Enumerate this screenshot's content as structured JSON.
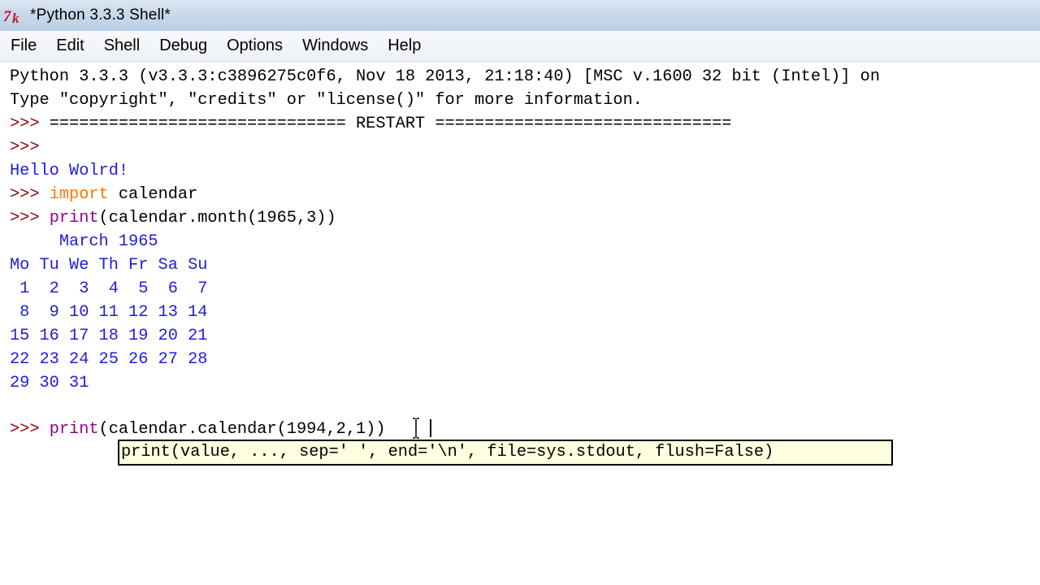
{
  "window": {
    "title": "*Python 3.3.3 Shell*",
    "icon": "tk-icon"
  },
  "menu": {
    "items": [
      "File",
      "Edit",
      "Shell",
      "Debug",
      "Options",
      "Windows",
      "Help"
    ]
  },
  "shell": {
    "banner_line1": "Python 3.3.3 (v3.3.3:c3896275c0f6, Nov 18 2013, 21:18:40) [MSC v.1600 32 bit (Intel)] on",
    "banner_line2": "Type \"copyright\", \"credits\" or \"license()\" for more information.",
    "prompt": ">>> ",
    "restart_line": "============================== RESTART ==============================",
    "hello_output": "Hello Wolrd!",
    "import_keyword": "import",
    "import_rest": " calendar",
    "print_builtin": "print",
    "print_month_rest": "(calendar.month(1965,3))",
    "calendar_title": "     March 1965",
    "calendar_header": "Mo Tu We Th Fr Sa Su",
    "calendar_week1": " 1  2  3  4  5  6  7",
    "calendar_week2": " 8  9 10 11 12 13 14",
    "calendar_week3": "15 16 17 18 19 20 21",
    "calendar_week4": "22 23 24 25 26 27 28",
    "calendar_week5": "29 30 31",
    "current_input_rest": "(calendar.calendar(1994,2,1))"
  },
  "calltip": {
    "text": "print(value, ..., sep=' ', end='\\n', file=sys.stdout, flush=False)"
  },
  "colors": {
    "titlebar": "#c9d8ea",
    "prompt": "#8a0000",
    "output_blue": "#1e1ed8",
    "keyword_orange": "#ff7700",
    "builtin_purple": "#900090",
    "calltip_bg": "#ffffe1"
  }
}
